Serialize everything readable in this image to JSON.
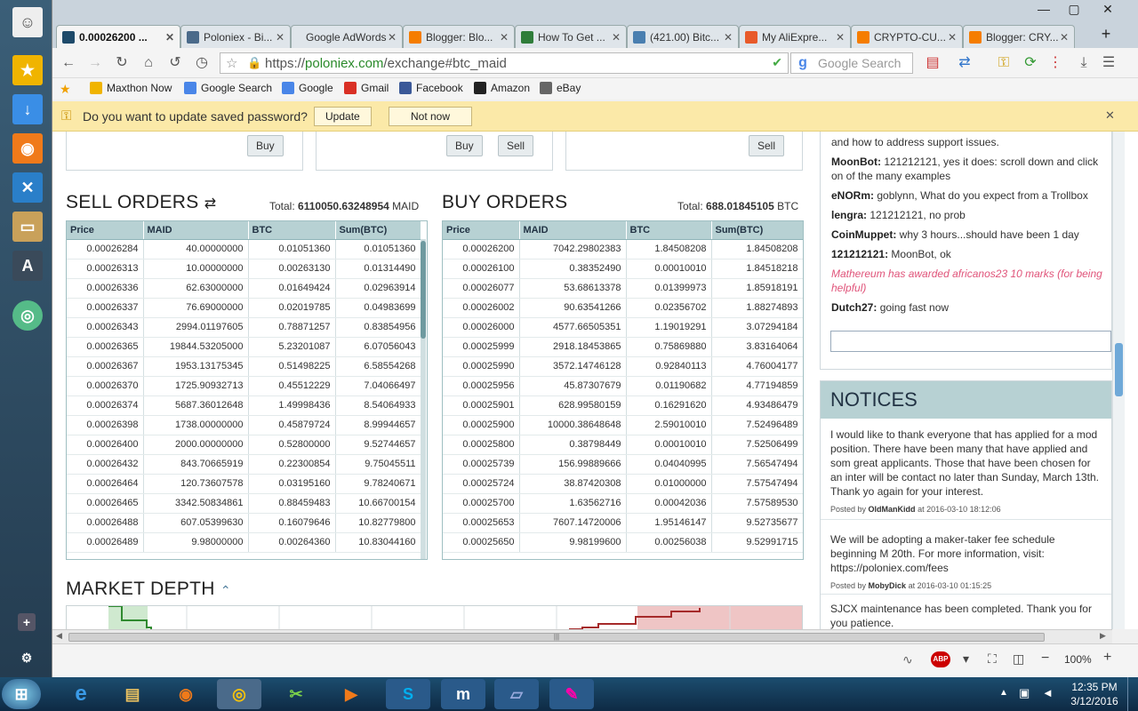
{
  "tabs": [
    {
      "title": "0.00026200 ...",
      "active": true
    },
    {
      "title": "Poloniex - Bi..."
    },
    {
      "title": "Google AdWords"
    },
    {
      "title": "Blogger: Blo..."
    },
    {
      "title": "How To Get ..."
    },
    {
      "title": "(421.00) Bitc..."
    },
    {
      "title": "My AliExpre..."
    },
    {
      "title": "CRYPTO-CU..."
    },
    {
      "title": "Blogger: CRY..."
    }
  ],
  "url": {
    "scheme": "https://",
    "domain": "poloniex.com",
    "path": "/exchange#btc_maid"
  },
  "search_placeholder": "Google Search",
  "bookmarks": [
    "Maxthon Now",
    "Google Search",
    "Google",
    "Gmail",
    "Facebook",
    "Amazon",
    "eBay"
  ],
  "password_bar": {
    "message": "Do you want to update saved password?",
    "update": "Update",
    "not_now": "Not now"
  },
  "trade_buttons": {
    "buy": "Buy",
    "sell": "Sell"
  },
  "sell_orders": {
    "title": "SELL ORDERS",
    "total_label": "Total:",
    "total_value": "6110050.63248954",
    "total_unit": "MAID",
    "columns": [
      "Price",
      "MAID",
      "BTC",
      "Sum(BTC)"
    ],
    "rows": [
      [
        "0.00026284",
        "40.00000000",
        "0.01051360",
        "0.01051360"
      ],
      [
        "0.00026313",
        "10.00000000",
        "0.00263130",
        "0.01314490"
      ],
      [
        "0.00026336",
        "62.63000000",
        "0.01649424",
        "0.02963914"
      ],
      [
        "0.00026337",
        "76.69000000",
        "0.02019785",
        "0.04983699"
      ],
      [
        "0.00026343",
        "2994.01197605",
        "0.78871257",
        "0.83854956"
      ],
      [
        "0.00026365",
        "19844.53205000",
        "5.23201087",
        "6.07056043"
      ],
      [
        "0.00026367",
        "1953.13175345",
        "0.51498225",
        "6.58554268"
      ],
      [
        "0.00026370",
        "1725.90932713",
        "0.45512229",
        "7.04066497"
      ],
      [
        "0.00026374",
        "5687.36012648",
        "1.49998436",
        "8.54064933"
      ],
      [
        "0.00026398",
        "1738.00000000",
        "0.45879724",
        "8.99944657"
      ],
      [
        "0.00026400",
        "2000.00000000",
        "0.52800000",
        "9.52744657"
      ],
      [
        "0.00026432",
        "843.70665919",
        "0.22300854",
        "9.75045511"
      ],
      [
        "0.00026464",
        "120.73607578",
        "0.03195160",
        "9.78240671"
      ],
      [
        "0.00026465",
        "3342.50834861",
        "0.88459483",
        "10.66700154"
      ],
      [
        "0.00026488",
        "607.05399630",
        "0.16079646",
        "10.82779800"
      ],
      [
        "0.00026489",
        "9.98000000",
        "0.00264360",
        "10.83044160"
      ]
    ]
  },
  "buy_orders": {
    "title": "BUY ORDERS",
    "total_label": "Total:",
    "total_value": "688.01845105",
    "total_unit": "BTC",
    "columns": [
      "Price",
      "MAID",
      "BTC",
      "Sum(BTC)"
    ],
    "rows": [
      [
        "0.00026200",
        "7042.29802383",
        "1.84508208",
        "1.84508208"
      ],
      [
        "0.00026100",
        "0.38352490",
        "0.00010010",
        "1.84518218"
      ],
      [
        "0.00026077",
        "53.68613378",
        "0.01399973",
        "1.85918191"
      ],
      [
        "0.00026002",
        "90.63541266",
        "0.02356702",
        "1.88274893"
      ],
      [
        "0.00026000",
        "4577.66505351",
        "1.19019291",
        "3.07294184"
      ],
      [
        "0.00025999",
        "2918.18453865",
        "0.75869880",
        "3.83164064"
      ],
      [
        "0.00025990",
        "3572.14746128",
        "0.92840113",
        "4.76004177"
      ],
      [
        "0.00025956",
        "45.87307679",
        "0.01190682",
        "4.77194859"
      ],
      [
        "0.00025901",
        "628.99580159",
        "0.16291620",
        "4.93486479"
      ],
      [
        "0.00025900",
        "10000.38648648",
        "2.59010010",
        "7.52496489"
      ],
      [
        "0.00025800",
        "0.38798449",
        "0.00010010",
        "7.52506499"
      ],
      [
        "0.00025739",
        "156.99889666",
        "0.04040995",
        "7.56547494"
      ],
      [
        "0.00025724",
        "38.87420308",
        "0.01000000",
        "7.57547494"
      ],
      [
        "0.00025700",
        "1.63562716",
        "0.00042036",
        "7.57589530"
      ],
      [
        "0.00025653",
        "7607.14720006",
        "1.95146147",
        "9.52735677"
      ],
      [
        "0.00025650",
        "9.98199600",
        "0.00256038",
        "9.52991715"
      ]
    ]
  },
  "market_depth": {
    "title": "MARKET DEPTH"
  },
  "chat": [
    {
      "user": "",
      "text": "and how to address support issues."
    },
    {
      "user": "MoonBot:",
      "text": "121212121, yes it does: scroll down and click on of the many examples"
    },
    {
      "user": "eNORm:",
      "text": "goblynn, What do you expect from a Trollbox"
    },
    {
      "user": "lengra:",
      "text": "121212121, no prob"
    },
    {
      "user": "CoinMuppet:",
      "text": "why 3 hours...should have been 1 day"
    },
    {
      "user": "121212121:",
      "text": "MoonBot, ok"
    },
    {
      "user": "",
      "text": "Mathereum has awarded africanos23 10 marks (for being helpful)",
      "system": true
    },
    {
      "user": "Dutch27:",
      "text": "going fast now"
    }
  ],
  "notices": {
    "title": "NOTICES",
    "items": [
      {
        "text": "I would like to thank everyone that has applied for a mod position. There have been many that have applied and som great applicants. Those that have been chosen for an inter will be contact no later than Sunday, March 13th. Thank yo again for your interest.",
        "posted_by": "Posted by",
        "author": "OldManKidd",
        "at": "at 2016-03-10 18:12:06"
      },
      {
        "text": "We will be adopting a maker-taker fee schedule beginning M 20th. For more information, visit: https://poloniex.com/fees",
        "posted_by": "Posted by",
        "author": "MobyDick",
        "at": "at 2016-03-10 01:15:25"
      },
      {
        "text": "SJCX maintenance has been completed. Thank you for you patience.",
        "posted_by": "",
        "author": "",
        "at": ""
      }
    ]
  },
  "status": {
    "zoom": "100%"
  },
  "clock": {
    "time": "12:35 PM",
    "date": "3/12/2016"
  },
  "colors": {
    "accent": "#b7d1d3",
    "pw_bar": "#fbe9a8",
    "system_msg": "#e0547a",
    "taskbar": "#0e2a44"
  }
}
